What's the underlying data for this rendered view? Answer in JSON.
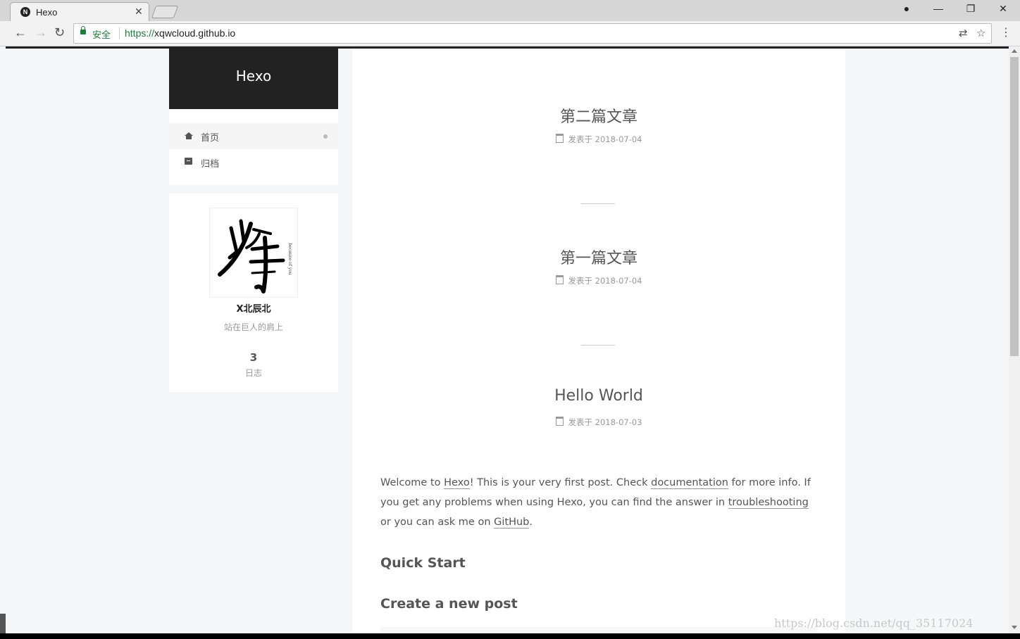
{
  "browser": {
    "tab_title": "Hexo",
    "tab_favicon": "N",
    "secure_label": "安全",
    "url_protocol": "https://",
    "url_host": "xqwcloud.github.io"
  },
  "sidebar": {
    "brand": "Hexo",
    "menu": [
      {
        "label": "首页",
        "icon": "home-icon",
        "active": true
      },
      {
        "label": "归档",
        "icon": "archive-icon",
        "active": false
      }
    ],
    "author": "X北辰北",
    "motto": "站在巨人的肩上",
    "posts_count": "3",
    "posts_label": "日志",
    "avatar_caption": "because of you"
  },
  "posts": [
    {
      "title": "第二篇文章",
      "meta_label": "发表于",
      "date": "2018-07-04"
    },
    {
      "title": "第一篇文章",
      "meta_label": "发表于",
      "date": "2018-07-04"
    },
    {
      "title": "Hello World",
      "meta_label": "发表于",
      "date": "2018-07-03"
    }
  ],
  "hello": {
    "p1": "Welcome to ",
    "link1": "Hexo",
    "p2": "! This is your very first post. Check ",
    "link2": "documentation",
    "p3": " for more info. If you get any problems when using Hexo, you can find the answer in ",
    "link3": "troubleshooting",
    "p4": " or you can ask me on ",
    "link4": "GitHub",
    "p5": ".",
    "h_quick": "Quick Start",
    "h_create": "Create a new post"
  },
  "watermark": "https://blog.csdn.net/qq_35117024"
}
